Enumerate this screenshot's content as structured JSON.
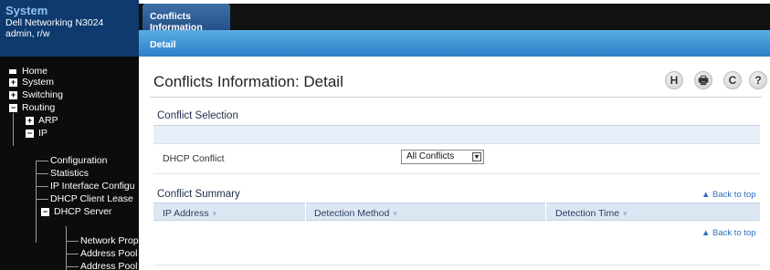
{
  "system": {
    "title": "System",
    "device": "Dell Networking N3024",
    "user": "admin, r/w"
  },
  "nav": {
    "items": [
      {
        "label": "Home",
        "indicator": ""
      },
      {
        "label": "System",
        "indicator": "+"
      },
      {
        "label": "Switching",
        "indicator": "+"
      },
      {
        "label": "Routing",
        "indicator": "−"
      },
      {
        "label": "ARP",
        "indicator": "+"
      },
      {
        "label": "IP",
        "indicator": "−"
      },
      {
        "label": "Configuration"
      },
      {
        "label": "Statistics"
      },
      {
        "label": "IP Interface Configu"
      },
      {
        "label": "DHCP Client Lease"
      },
      {
        "label": "DHCP Server",
        "indicator": "−"
      },
      {
        "label": "Network Prope"
      },
      {
        "label": "Address Pool"
      },
      {
        "label": "Address Pool C"
      }
    ]
  },
  "tabs": {
    "main": "Conflicts Information",
    "sub": "Detail"
  },
  "page": {
    "title": "Conflicts Information: Detail",
    "toolbar": {
      "help": "H",
      "print": "🖶",
      "refresh": "C",
      "question": "?"
    }
  },
  "conflict_selection": {
    "title": "Conflict Selection",
    "field_label": "DHCP Conflict",
    "selected": "All Conflicts"
  },
  "conflict_summary": {
    "title": "Conflict Summary",
    "back_to_top": "▲ Back to top",
    "columns": [
      "IP Address",
      "Detection Method",
      "Detection Time"
    ],
    "sort_glyph": "▾"
  }
}
